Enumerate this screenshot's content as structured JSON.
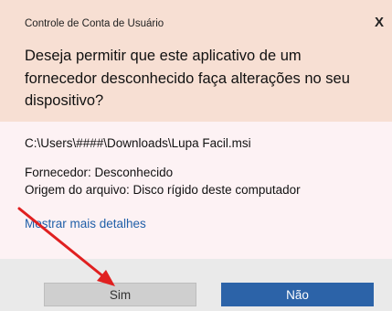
{
  "dialog": {
    "title": "Controle de Conta de Usuário",
    "close_label": "X",
    "question": "Deseja permitir que este aplicativo de um fornecedor desconhecido faça alterações no seu dispositivo?",
    "file_path": "C:\\Users\\####\\Downloads\\Lupa Facil.msi",
    "vendor": "Fornecedor: Desconhecido",
    "origin": "Origem do arquivo: Disco rígido deste computador",
    "more_details": "Mostrar mais detalhes",
    "yes_label": "Sim",
    "no_label": "Não"
  },
  "colors": {
    "header_bg": "#f7dfd3",
    "body_bg": "#fdf2f4",
    "footer_bg": "#eaeaea",
    "link": "#1f5fa8",
    "primary_button": "#2c63a8",
    "annotation_arrow": "#e02020"
  }
}
